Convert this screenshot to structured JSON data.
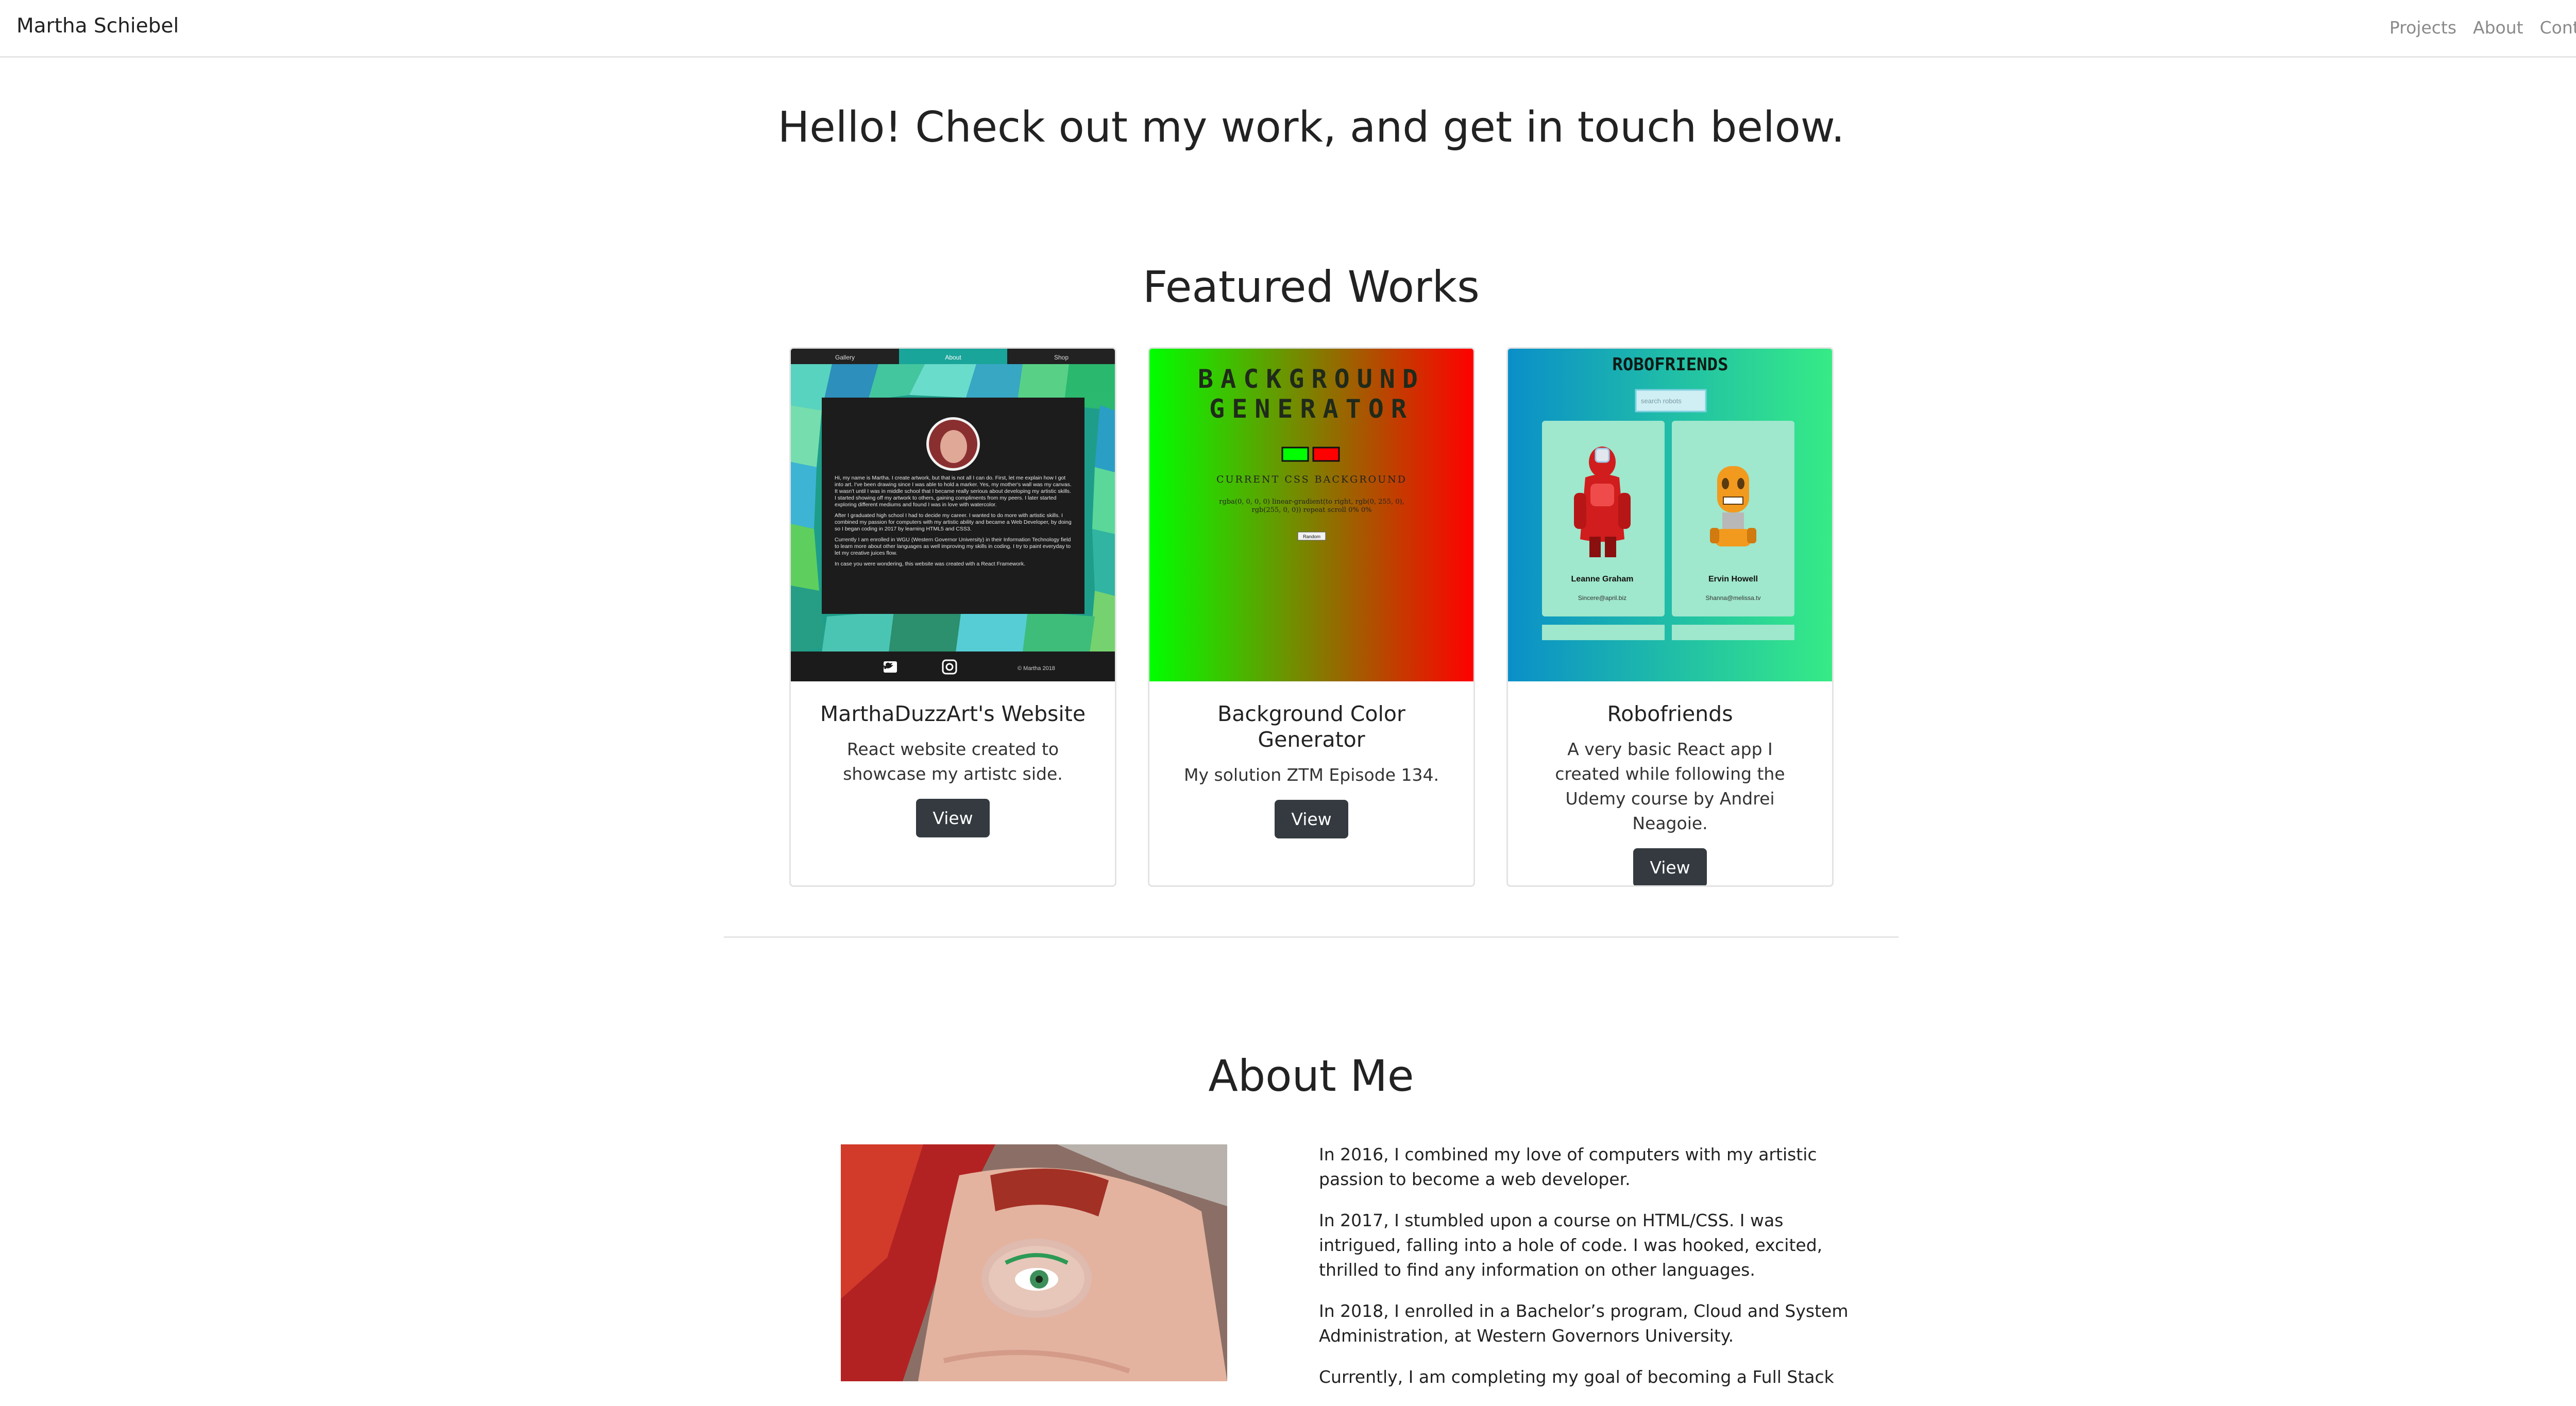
{
  "nav": {
    "brand": "Martha Schiebel",
    "links": [
      "Projects",
      "About",
      "Contact"
    ]
  },
  "hero": {
    "title": "Hello! Check out my work, and get in touch below."
  },
  "featured": {
    "title": "Featured Works",
    "cards": [
      {
        "title": "MarthaDuzzArt's Website",
        "text": "React website created to showcase my artistc side.",
        "button": "View",
        "screenshot": {
          "tabs": [
            "Gallery",
            "About",
            "Shop"
          ],
          "paragraphs": [
            "Hi, my name is Martha. I create artwork, but that is not all I can do. First, let me explain how I got into art. I've been drawing since I was able to hold a marker. Yes, my mother's wall was my canvas. It wasn't until I was in middle school that I became really serious about developing my artistic skills. I started showing off my artwork to others, gaining compliments from my peers. I later started exploring different mediums and found I was in love with watercolor.",
            "After I graduated high school I had to decide my career. I wanted to do more with artistic skills. I combined my passion for computers with my artistic ability and became a Web Developer, by doing so I began coding in 2017 by learning HTML5 and CSS3.",
            "Currently I am enrolled in WGU (Western Governor University) in their Information Technology field to learn more about other languages as well improving my skills in coding. I try to paint everyday to let my creative juices flow.",
            "In case you were wondering, this website was created with a React Framework."
          ],
          "footer": "© Martha 2018"
        }
      },
      {
        "title": "Background Color Generator",
        "text": "My solution ZTM Episode 134.",
        "button": "View",
        "screenshot": {
          "heading": "BACKGROUND GENERATOR",
          "subheading": "CURRENT CSS BACKGROUND",
          "css": "rgba(0, 0, 0, 0) linear-gradient(to right, rgb(0, 255, 0), rgb(255, 0, 0)) repeat scroll 0% 0%",
          "button": "Random",
          "color1": "#00ff00",
          "color2": "#ff0000"
        }
      },
      {
        "title": "Robofriends",
        "text": "A very basic React app I created while following the Udemy course by Andrei Neagoie.",
        "button": "View",
        "screenshot": {
          "heading": "ROBOFRIENDS",
          "search_placeholder": "search robots",
          "robots": [
            {
              "name": "Leanne Graham",
              "email": "Sincere@april.biz"
            },
            {
              "name": "Ervin Howell",
              "email": "Shanna@melissa.tv"
            }
          ]
        }
      }
    ]
  },
  "about": {
    "title": "About Me",
    "paragraphs": [
      "In 2016, I combined my love of computers with my artistic passion to become a web developer.",
      "In 2017, I stumbled upon a course on HTML/CSS. I was intrigued, falling into a hole of code. I was hooked, excited, thrilled to find any information on other languages.",
      "In 2018, I enrolled in a Bachelor’s program, Cloud and System Administration, at Western Governors University.",
      "Currently, I am completing my goal of becoming a Full Stack"
    ]
  },
  "colors": {
    "button_bg": "#343a40",
    "nav_link": "#8a8a8a",
    "robo_card": "#9fe7cd"
  }
}
